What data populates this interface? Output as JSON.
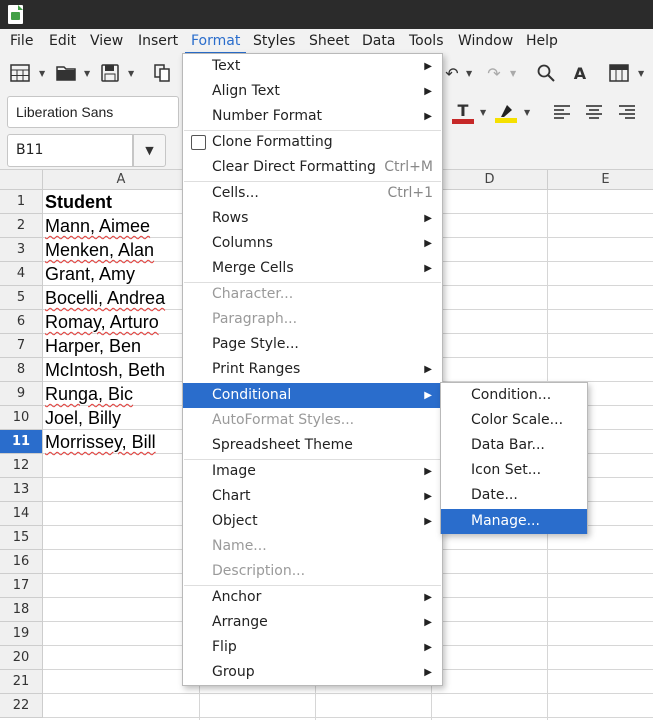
{
  "menubar": {
    "items": [
      "File",
      "Edit",
      "View",
      "Insert",
      "Format",
      "Styles",
      "Sheet",
      "Data",
      "Tools",
      "Window",
      "Help"
    ],
    "active": "Format"
  },
  "toolbar": {
    "font_name": "Liberation Sans",
    "name_box": "B11",
    "font_color": "#c62828",
    "highlight_color": "#f5e000",
    "icons": [
      "table-icon",
      "open-icon",
      "save-icon",
      "clone-icon",
      "undo-icon",
      "redo-icon",
      "find-icon",
      "spelling-icon",
      "border-icon",
      "font-color-icon",
      "highlight-icon",
      "align-left-icon",
      "align-center-icon",
      "align-right-icon"
    ]
  },
  "sheet": {
    "columns": [
      "A",
      "D",
      "E"
    ],
    "rows": [
      "1",
      "2",
      "3",
      "4",
      "5",
      "6",
      "7",
      "8",
      "9",
      "10",
      "11",
      "12",
      "13",
      "14",
      "15",
      "16",
      "17",
      "18",
      "19",
      "20",
      "21",
      "22"
    ],
    "selected_row": "11",
    "cells": [
      "Student",
      "Mann, Aimee",
      "Menken, Alan",
      "Grant, Amy",
      "Bocelli, Andrea",
      "Romay, Arturo",
      "Harper, Ben",
      "McIntosh, Beth",
      "Runga, Bic",
      "Joel, Billy",
      "Morrissey, Bill"
    ]
  },
  "format_menu": {
    "text": "Text",
    "align_text": "Align Text",
    "number_format": "Number Format",
    "clone_formatting": "Clone Formatting",
    "clear_direct": "Clear Direct Formatting",
    "clear_direct_shortcut": "Ctrl+M",
    "cells": "Cells...",
    "cells_shortcut": "Ctrl+1",
    "rows": "Rows",
    "columns": "Columns",
    "merge_cells": "Merge Cells",
    "character": "Character...",
    "paragraph": "Paragraph...",
    "page_style": "Page Style...",
    "print_ranges": "Print Ranges",
    "conditional": "Conditional",
    "autoformat": "AutoFormat Styles...",
    "spreadsheet_theme": "Spreadsheet Theme",
    "image": "Image",
    "chart": "Chart",
    "object": "Object",
    "name": "Name...",
    "description": "Description...",
    "anchor": "Anchor",
    "arrange": "Arrange",
    "flip": "Flip",
    "group": "Group"
  },
  "conditional_submenu": {
    "condition": "Condition...",
    "color_scale": "Color Scale...",
    "data_bar": "Data Bar...",
    "icon_set": "Icon Set...",
    "date": "Date...",
    "manage": "Manage..."
  },
  "accent_color": "#2a6dcc"
}
